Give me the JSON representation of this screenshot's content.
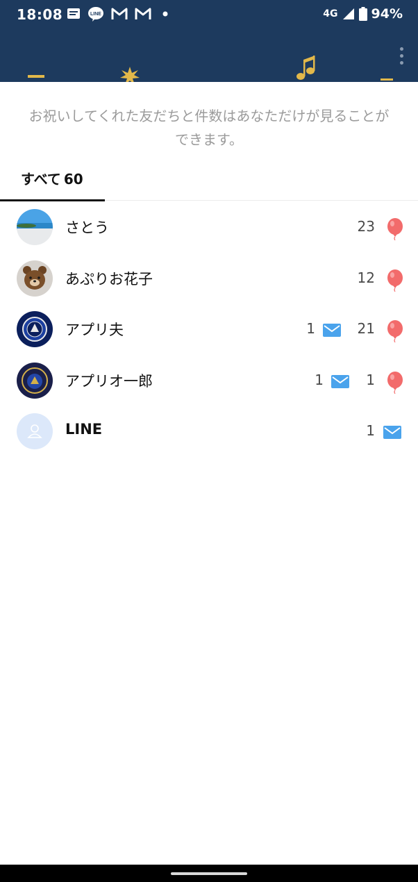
{
  "status_bar": {
    "time": "18:08",
    "notification_icons": [
      "messages-icon",
      "line-icon",
      "gmail-icon",
      "gmail-icon",
      "dot-icon"
    ],
    "network": "4G",
    "battery": "94%"
  },
  "header": {
    "background_color": "#1d3a5e",
    "menu_icon": "more-vertical-icon"
  },
  "notice": "お祝いしてくれた友だちと件数はあなただけが見ることができます。",
  "tabs": [
    {
      "label": "すべて",
      "count": "60",
      "selected": true
    }
  ],
  "friends": [
    {
      "name": "さとう",
      "avatar": "beach-photo",
      "message_count": "",
      "balloon_count": "23"
    },
    {
      "name": "あぷりお花子",
      "avatar": "bear-photo",
      "message_count": "",
      "balloon_count": "12"
    },
    {
      "name": "アプリ夫",
      "avatar": "chelsea-crest",
      "message_count": "1",
      "balloon_count": "21"
    },
    {
      "name": "アプリオ一郎",
      "avatar": "chelsea-crest",
      "message_count": "1",
      "balloon_count": "1"
    },
    {
      "name": "LINE",
      "avatar": "default-user",
      "message_count": "1",
      "balloon_count": ""
    }
  ],
  "colors": {
    "balloon": "#f26b6b",
    "envelope": "#4aa3ec",
    "notice_text": "#9b9b9b"
  }
}
